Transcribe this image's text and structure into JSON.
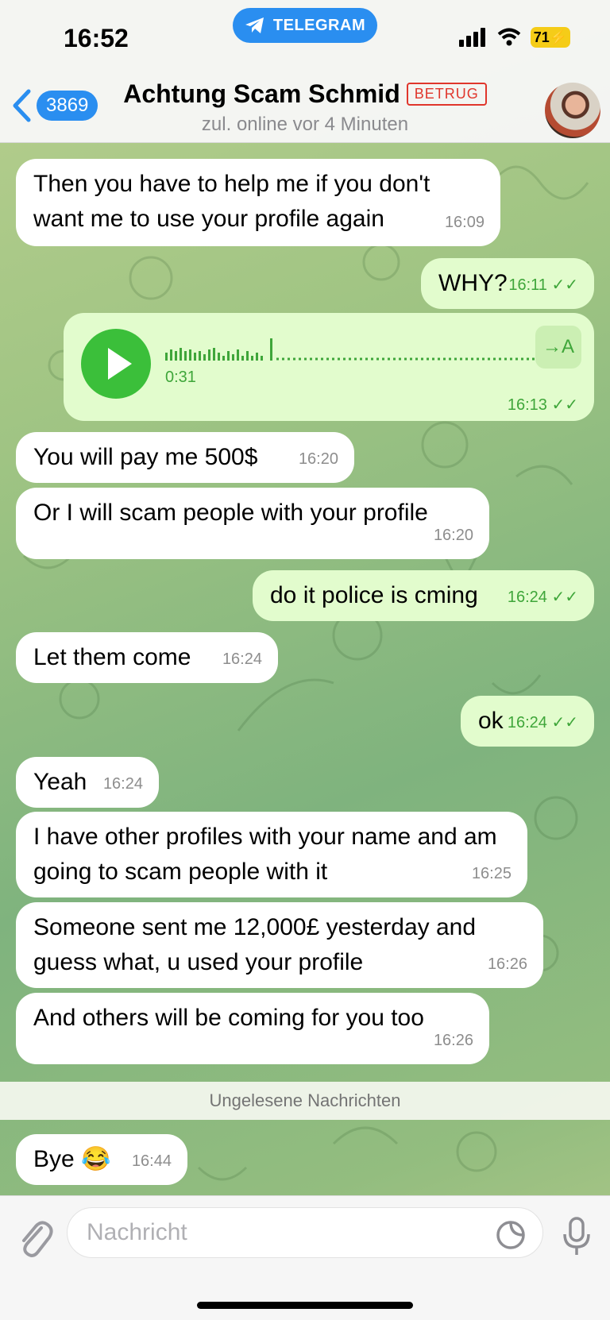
{
  "status_bar": {
    "time": "16:52",
    "app_pill": "TELEGRAM",
    "battery": "71"
  },
  "header": {
    "back_count": "3869",
    "title": "Achtung Scam Schmid",
    "tag": "BETRUG",
    "subtitle": "zul. online vor 4 Minuten"
  },
  "messages": [
    {
      "text": "Then you have to help me if you don't want me to use your profile again",
      "time": "16:09"
    },
    {
      "text": "WHY?",
      "time": "16:11"
    },
    {
      "text": "",
      "time": "16:13"
    },
    {
      "text": "You will pay me 500$",
      "time": "16:20"
    },
    {
      "text": "Or I will scam people with your profile",
      "time": "16:20"
    },
    {
      "text": "do it police is cming",
      "time": "16:24"
    },
    {
      "text": "Let them come",
      "time": "16:24"
    },
    {
      "text": "ok",
      "time": "16:24"
    },
    {
      "text": "Yeah",
      "time": "16:24"
    },
    {
      "text": "I have other profiles with your name and am going to scam people with it",
      "time": "16:25"
    },
    {
      "text": "Someone sent me 12,000£ yesterday and guess what, u used your profile",
      "time": "16:26"
    },
    {
      "text": "And others will be coming for you too",
      "time": "16:26"
    },
    {
      "text": "Bye 😂",
      "time": "16:44"
    }
  ],
  "voice_message": {
    "duration": "0:31",
    "transcribe_label": "→A"
  },
  "unread_divider": "Ungelesene Nachrichten",
  "composer": {
    "placeholder": "Nachricht"
  },
  "colors": {
    "accent": "#2a8ef0",
    "out_bubble": "#e2fccd",
    "in_bubble": "#ffffff",
    "danger": "#e0362c"
  }
}
